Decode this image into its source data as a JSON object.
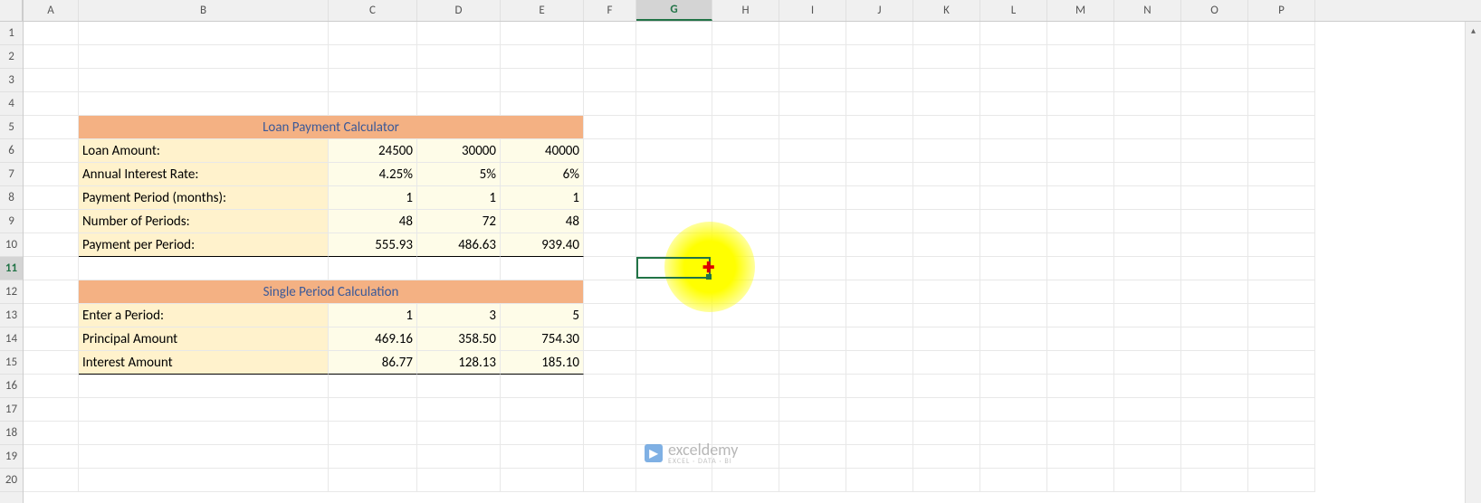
{
  "columns": [
    "A",
    "B",
    "C",
    "D",
    "E",
    "F",
    "G",
    "H",
    "I",
    "J",
    "K",
    "L",
    "M",
    "N",
    "O",
    "P"
  ],
  "rows": [
    1,
    2,
    3,
    4,
    5,
    6,
    7,
    8,
    9,
    10,
    11,
    12,
    13,
    14,
    15,
    16,
    17,
    18,
    19,
    20
  ],
  "active_cell": {
    "col": "G",
    "row": 11
  },
  "headers": {
    "loan_calc": "Loan Payment Calculator",
    "single_period": "Single Period Calculation"
  },
  "labels": {
    "loan_amount": "Loan Amount:",
    "annual_rate": "Annual Interest Rate:",
    "payment_period": "Payment Period (months):",
    "num_periods": "Number of Periods:",
    "payment_per_period": "Payment per Period:",
    "enter_period": "Enter a Period:",
    "principal": "Principal Amount",
    "interest": "Interest Amount"
  },
  "data": {
    "r6": {
      "c": "24500",
      "d": "30000",
      "e": "40000"
    },
    "r7": {
      "c": "4.25%",
      "d": "5%",
      "e": "6%"
    },
    "r8": {
      "c": "1",
      "d": "1",
      "e": "1"
    },
    "r9": {
      "c": "48",
      "d": "72",
      "e": "48"
    },
    "r10": {
      "c": "555.93",
      "d": "486.63",
      "e": "939.40"
    },
    "r13": {
      "c": "1",
      "d": "3",
      "e": "5"
    },
    "r14": {
      "c": "469.16",
      "d": "358.50",
      "e": "754.30"
    },
    "r15": {
      "c": "86.77",
      "d": "128.13",
      "e": "185.10"
    }
  },
  "watermark": {
    "brand": "exceldemy",
    "tagline": "EXCEL · DATA · BI"
  },
  "scroll": {
    "up": "▴",
    "down": "▾"
  }
}
